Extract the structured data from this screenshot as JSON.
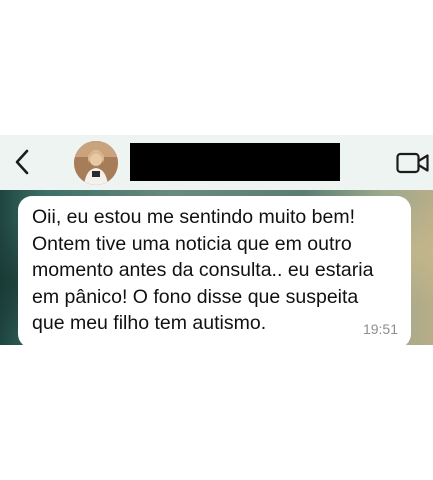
{
  "chat_header": {
    "back_icon": "chevron-left-icon",
    "avatar_icon": "contact-avatar",
    "name_redacted": true,
    "video_icon": "video-camera-icon"
  },
  "message": {
    "text": "Oii, eu estou me sentindo muito bem!\nOntem tive uma noticia que em outro\nmomento antes da consulta.. eu estaria\nem pânico! O fono disse que suspeita\nque meu filho tem autismo.",
    "time": "19:51"
  },
  "colors": {
    "header_bg": "#eef4f2",
    "icon_color": "#1c1c1e",
    "bubble_bg": "#ffffff",
    "time_color": "#8e8e93"
  }
}
